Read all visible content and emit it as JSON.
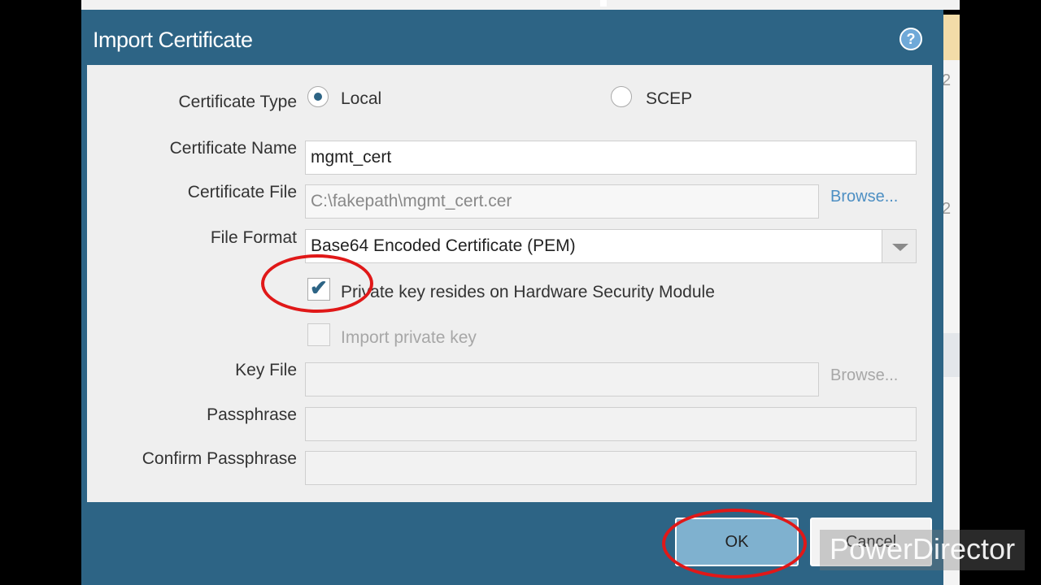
{
  "dialog": {
    "title": "Import Certificate",
    "help_icon": "help-icon"
  },
  "background": {
    "right_numbers": [
      "2",
      "2"
    ]
  },
  "form": {
    "certificate_type": {
      "label": "Certificate Type",
      "options": [
        {
          "label": "Local",
          "selected": true
        },
        {
          "label": "SCEP",
          "selected": false
        }
      ]
    },
    "certificate_name": {
      "label": "Certificate Name",
      "value": "mgmt_cert"
    },
    "certificate_file": {
      "label": "Certificate File",
      "value": "C:\\fakepath\\mgmt_cert.cer",
      "browse": "Browse..."
    },
    "file_format": {
      "label": "File Format",
      "value": "Base64 Encoded Certificate (PEM)"
    },
    "hsm_checkbox": {
      "label": "Private key resides on Hardware Security Module",
      "checked": true
    },
    "import_key_checkbox": {
      "label": "Import private key",
      "checked": false,
      "disabled": true
    },
    "key_file": {
      "label": "Key File",
      "value": "",
      "browse": "Browse..."
    },
    "passphrase": {
      "label": "Passphrase",
      "value": ""
    },
    "confirm_passphrase": {
      "label": "Confirm Passphrase",
      "value": ""
    }
  },
  "buttons": {
    "ok": "OK",
    "cancel": "Cancel"
  },
  "watermark": "PowerDirector",
  "colors": {
    "dialog_header": "#2d6485",
    "panel": "#efefef",
    "link": "#4d8fc3",
    "annotation": "#e01818",
    "ok_button": "#7fb1cf"
  }
}
